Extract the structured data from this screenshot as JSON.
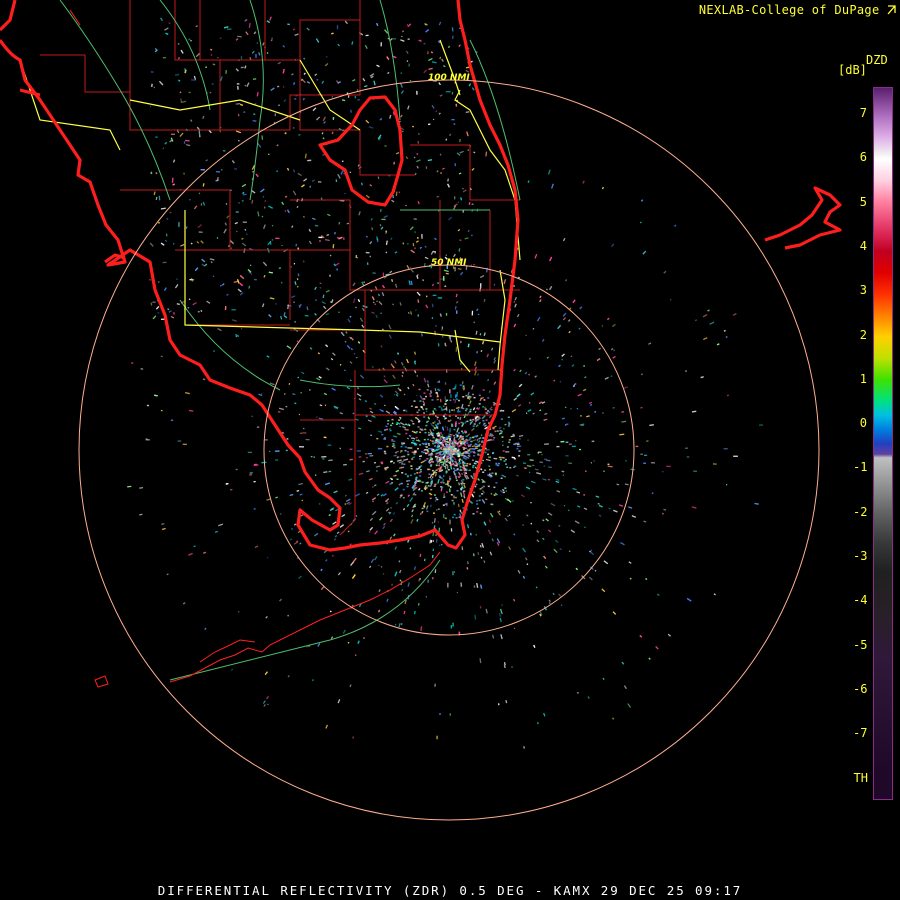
{
  "credit": "NEXLAB-College of DuPage",
  "credit_icon": "arrow-icon",
  "caption": "DIFFERENTIAL REFLECTIVITY (ZDR) 0.5 DEG - KAMX 29 DEC 25 09:17",
  "legend": {
    "product": "DZD",
    "unit": "[dB]",
    "ticks": [
      "7",
      "6",
      "5",
      "4",
      "3",
      "2",
      "1",
      "0",
      "-1",
      "-2",
      "-3",
      "-4",
      "-5",
      "-6",
      "-7",
      "TH"
    ]
  },
  "range_rings": [
    "50 NMI",
    "100 NMI"
  ],
  "colors": {
    "coast": "#ff2020",
    "county": "#cc1818",
    "state_roads": "#ffff44",
    "rivers": "#4fbf6f",
    "ring": "#ffb090",
    "text": "#ffff33"
  }
}
